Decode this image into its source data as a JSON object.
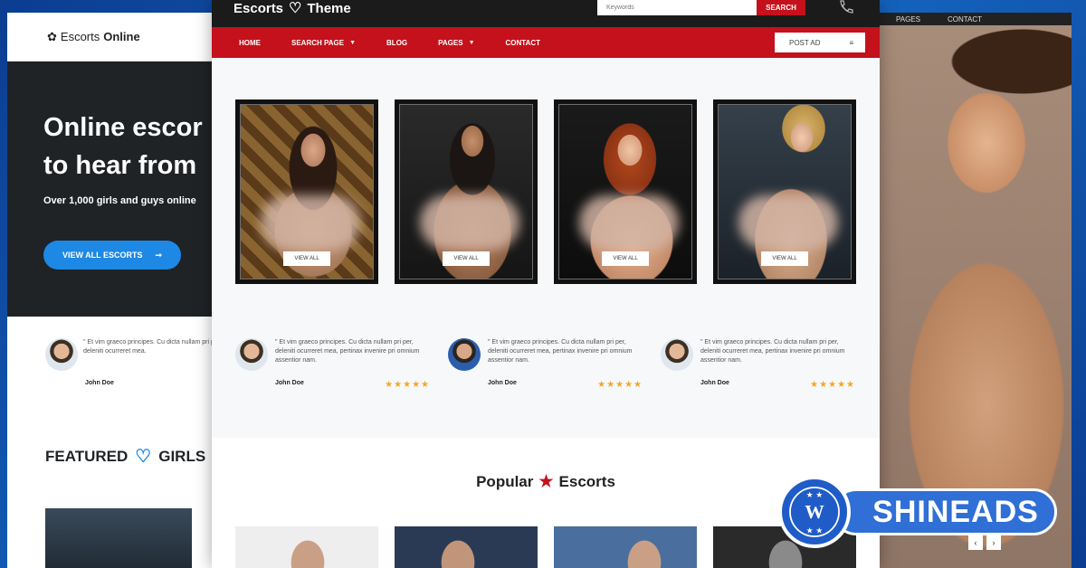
{
  "left_site": {
    "logo_prefix": "Escorts",
    "logo_suffix": "Online",
    "hero_line1": "Online escor",
    "hero_line2": "to hear from",
    "hero_sub": "Over 1,000 girls and guys online",
    "cta_label": "VIEW ALL ESCORTS",
    "testimonial_quote": "\" Et vim graeco principes. Cu dicta nullam pri per, deleniti ocurreret mea.",
    "testimonial_author": "John Doe",
    "featured_label": "FEATURED",
    "featured_label2": "GIRLS"
  },
  "right_site": {
    "nav": [
      "PAGES",
      "CONTACT"
    ],
    "pager": [
      "‹",
      "›"
    ]
  },
  "main_site": {
    "brand_part1": "Escorts",
    "brand_part2": "Theme",
    "search_placeholder": "Keywords",
    "search_button": "SEARCH",
    "nav": [
      "HOME",
      "SEARCH PAGE",
      "BLOG",
      "PAGES",
      "CONTACT"
    ],
    "post_ad": "POST AD",
    "cards": [
      {
        "button": "VIEW ALL"
      },
      {
        "button": "VIEW ALL"
      },
      {
        "button": "VIEW ALL"
      },
      {
        "button": "VIEW ALL"
      }
    ],
    "testimonials": [
      {
        "quote": "\" Et vim graeco principes. Cu dicta nullam pri per, deleniti ocurreret mea, pertinax invenire pri omnium assentior nam.",
        "author": "John Doe",
        "stars": "★★★★★"
      },
      {
        "quote": "\" Et vim graeco principes. Cu dicta nullam pri per, deleniti ocurreret mea, pertinax invenire pri omnium assentior nam.",
        "author": "John Doe",
        "stars": "★★★★★"
      },
      {
        "quote": "\" Et vim graeco principes. Cu dicta nullam pri per, deleniti ocurreret mea, pertinax invenire pri omnium assentior nam.",
        "author": "John Doe",
        "stars": "★★★★★"
      }
    ],
    "popular_word1": "Popular",
    "popular_word2": "Escorts"
  },
  "badge": {
    "text": "SHINEADS"
  },
  "colors": {
    "accent_red": "#c4111b",
    "accent_blue": "#1e88e5",
    "star_gold": "#f5a623"
  }
}
